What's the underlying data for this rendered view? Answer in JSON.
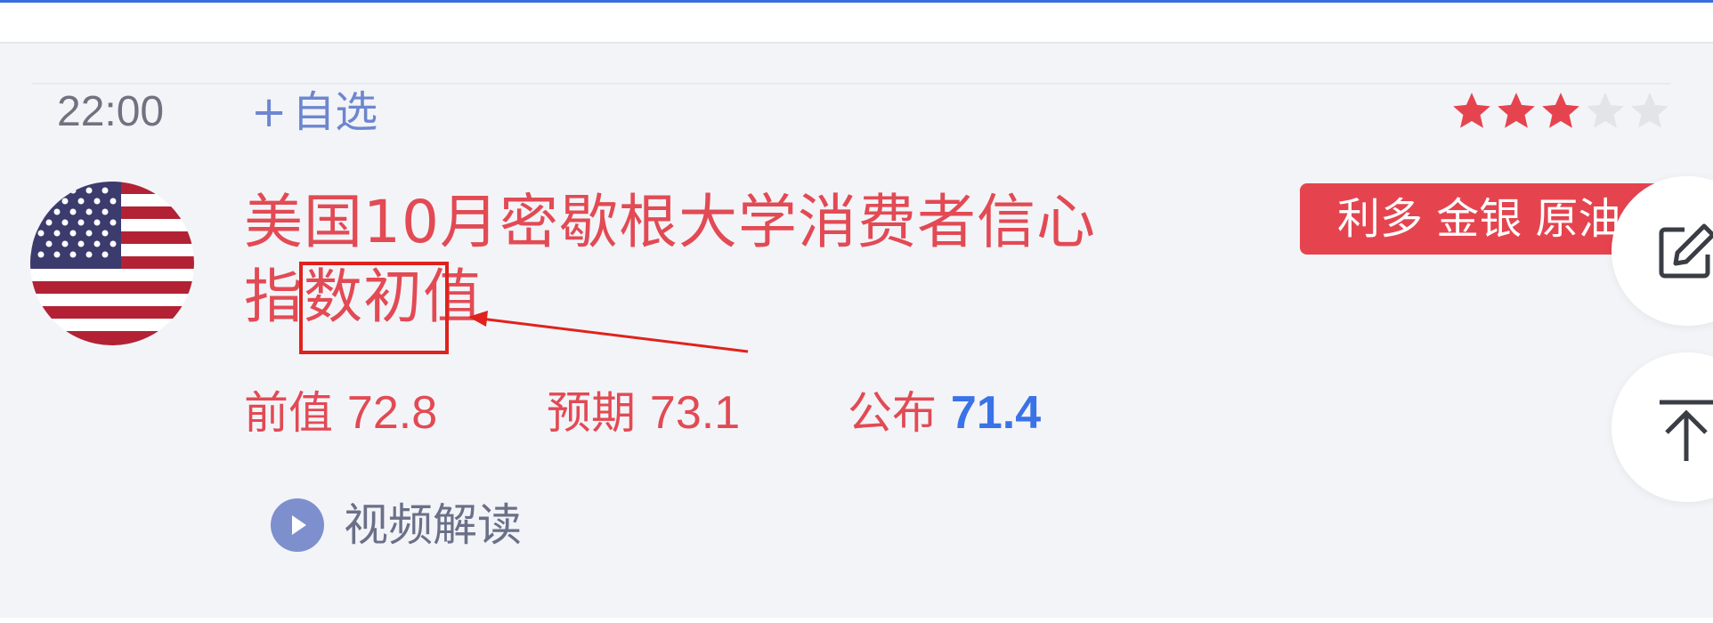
{
  "event": {
    "time": "22:00",
    "add_watch_plus": "+",
    "add_watch_label": "自选",
    "importance_stars": 3,
    "importance_max": 5,
    "title": "美国10月密歇根大学消费者信心指数初值",
    "tag": "利多 金银 原油",
    "country": "United States",
    "metrics": {
      "previous_label": "前值",
      "previous_value": "72.8",
      "forecast_label": "预期",
      "forecast_value": "73.1",
      "actual_label": "公布",
      "actual_value": "71.4"
    },
    "video_label": "视频解读"
  },
  "float_buttons": {
    "edit_icon": "edit-icon",
    "back_to_top_icon": "back-to-top-icon"
  },
  "colors": {
    "accent_blue": "#3a72e8",
    "title_red": "#e24a54",
    "tag_red": "#e5444f",
    "star_red": "#e5444f",
    "star_gray": "#e3e4e8",
    "annotation_red": "#e0221d"
  }
}
